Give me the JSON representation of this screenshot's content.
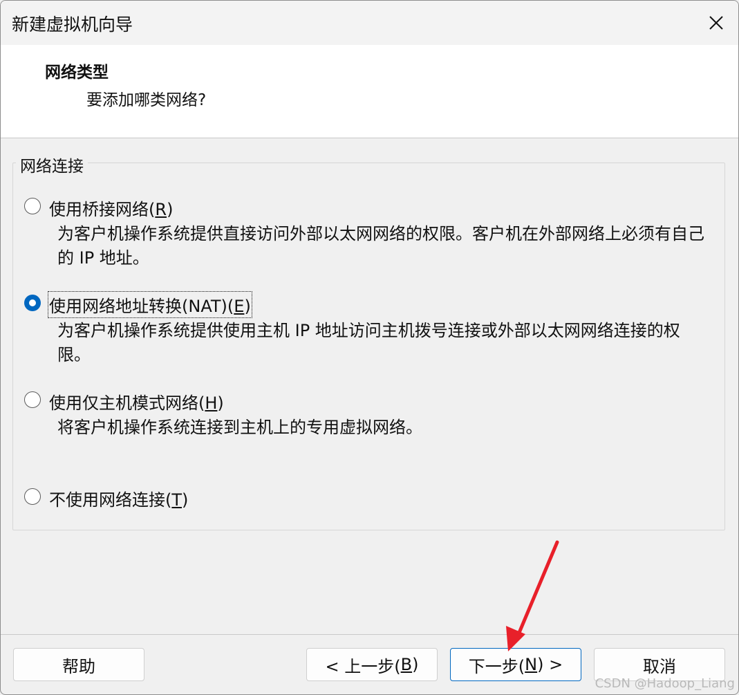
{
  "window": {
    "title": "新建虚拟机向导"
  },
  "header": {
    "title": "网络类型",
    "subtitle": "要添加哪类网络?"
  },
  "group": {
    "legend": "网络连接"
  },
  "options": [
    {
      "label_pre": "使用桥接网络(",
      "accel": "R",
      "label_post": ")",
      "desc": "为客户机操作系统提供直接访问外部以太网网络的权限。客户机在外部网络上必须有自己的 IP 地址。",
      "checked": false
    },
    {
      "label_pre": "使用网络地址转换(NAT)(",
      "accel": "E",
      "label_post": ")",
      "desc": "为客户机操作系统提供使用主机 IP 地址访问主机拨号连接或外部以太网网络连接的权限。",
      "checked": true
    },
    {
      "label_pre": "使用仅主机模式网络(",
      "accel": "H",
      "label_post": ")",
      "desc": "将客户机操作系统连接到主机上的专用虚拟网络。",
      "checked": false
    },
    {
      "label_pre": "不使用网络连接(",
      "accel": "T",
      "label_post": ")",
      "desc": "",
      "checked": false
    }
  ],
  "buttons": {
    "help": "帮助",
    "back_pre": "< 上一步(",
    "back_accel": "B",
    "back_post": ")",
    "next_pre": "下一步(",
    "next_accel": "N",
    "next_post": ") >",
    "cancel": "取消"
  },
  "annotation": {
    "arrow_color": "#e8202a"
  },
  "watermark": "CSDN @Hadoop_Liang"
}
